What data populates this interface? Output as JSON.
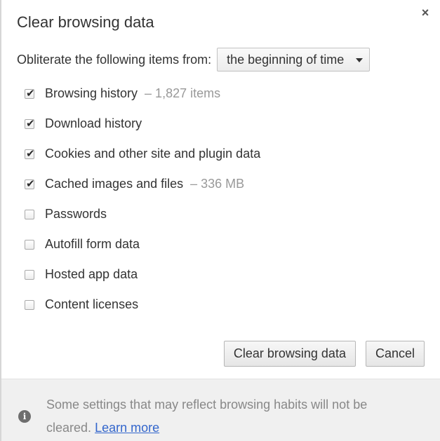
{
  "dialog": {
    "title": "Clear browsing data",
    "close_label": "×"
  },
  "range": {
    "label": "Obliterate the following items from:",
    "selected": "the beginning of time"
  },
  "options": [
    {
      "label": "Browsing history",
      "detail": "–  1,827 items",
      "checked": true
    },
    {
      "label": "Download history",
      "detail": "",
      "checked": true
    },
    {
      "label": "Cookies and other site and plugin data",
      "detail": "",
      "checked": true
    },
    {
      "label": "Cached images and files",
      "detail": "–  336 MB",
      "checked": true
    },
    {
      "label": "Passwords",
      "detail": "",
      "checked": false
    },
    {
      "label": "Autofill form data",
      "detail": "",
      "checked": false
    },
    {
      "label": "Hosted app data",
      "detail": "",
      "checked": false
    },
    {
      "label": "Content licenses",
      "detail": "",
      "checked": false
    }
  ],
  "buttons": {
    "clear_label": "Clear browsing data",
    "cancel_label": "Cancel"
  },
  "footer": {
    "icon": "info-icon",
    "icon_glyph": "i",
    "text": "Some settings that may reflect browsing habits will not be cleared.",
    "link": "Learn more"
  },
  "colors": {
    "link": "#3366cc",
    "footer_bg": "#f0f0f0",
    "muted_text": "#999999"
  }
}
